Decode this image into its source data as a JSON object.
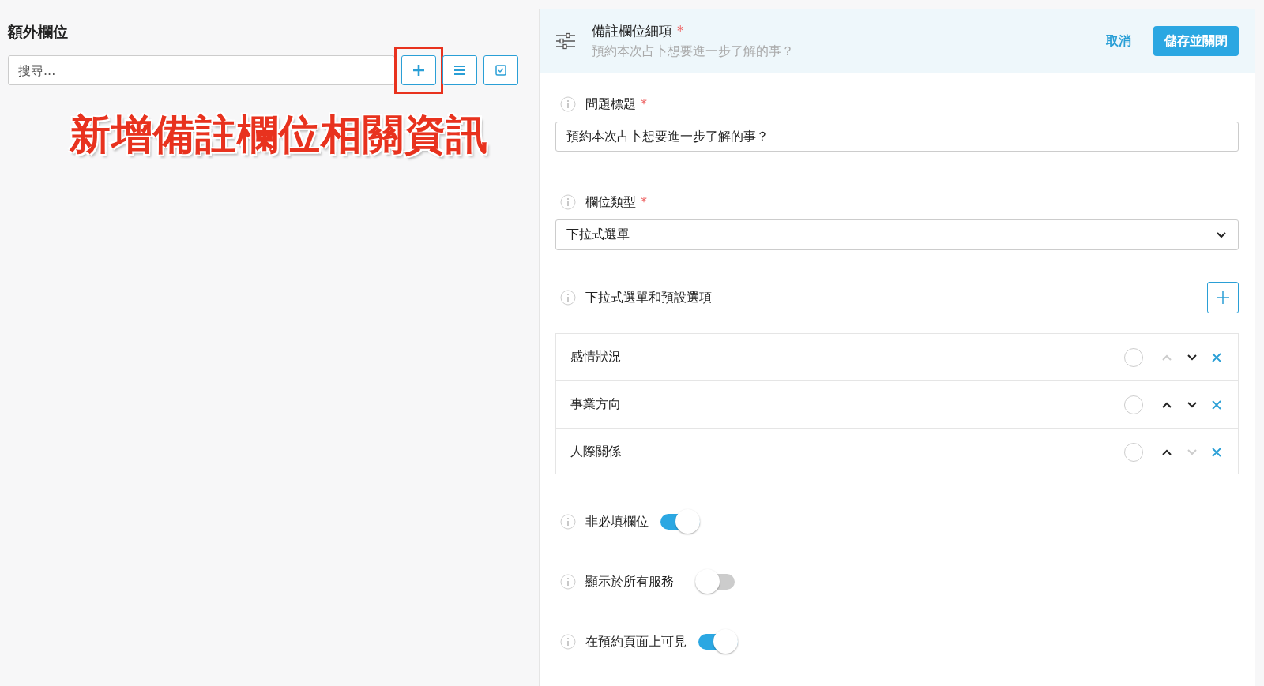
{
  "sidebar": {
    "title": "額外欄位",
    "search": {
      "placeholder": "搜尋..."
    },
    "buttons": [
      {
        "kind": "add",
        "highlighted": true
      },
      {
        "kind": "list",
        "highlighted": false
      },
      {
        "kind": "select",
        "highlighted": false
      }
    ],
    "annotation": "新增備註欄位相關資訊"
  },
  "panel": {
    "header": {
      "title": "備註欄位細項",
      "required_mark": "*",
      "subtitle": "預約本次占卜想要進一步了解的事？",
      "cancel": "取消",
      "save": "儲存並關閉"
    },
    "question": {
      "label": "問題標題",
      "required_mark": "*",
      "value": "預約本次占卜想要進一步了解的事？"
    },
    "field_type": {
      "label": "欄位類型",
      "required_mark": "*",
      "value": "下拉式選單"
    },
    "options_section": {
      "label": "下拉式選單和預設選項"
    },
    "options": [
      {
        "label": "感情狀況",
        "selected": false,
        "up_enabled": false,
        "down_enabled": true
      },
      {
        "label": "事業方向",
        "selected": false,
        "up_enabled": true,
        "down_enabled": true
      },
      {
        "label": "人際關係",
        "selected": false,
        "up_enabled": true,
        "down_enabled": false
      }
    ],
    "toggles": [
      {
        "label": "非必填欄位",
        "on": true
      },
      {
        "label": "顯示於所有服務",
        "on": false
      },
      {
        "label": "在預約頁面上可見",
        "on": true
      }
    ]
  }
}
